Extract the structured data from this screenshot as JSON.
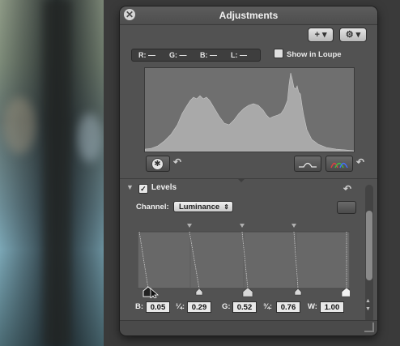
{
  "window": {
    "title": "Adjustments"
  },
  "toolbar": {
    "add_label": "+ ▾",
    "gear_label": "⚙ ▾"
  },
  "readout": {
    "r": "R: —",
    "g": "G: —",
    "b": "B: —",
    "l": "L: —"
  },
  "loupe": {
    "label": "Show in Loupe"
  },
  "levels": {
    "title": "Levels",
    "channel_label": "Channel:",
    "channel_value": "Luminance",
    "fields": [
      {
        "label": "B:",
        "value": "0.05"
      },
      {
        "label": "¼:",
        "value": "0.29"
      },
      {
        "label": "G:",
        "value": "0.52"
      },
      {
        "label": "¾:",
        "value": "0.76"
      },
      {
        "label": "W:",
        "value": "1.00"
      }
    ]
  },
  "icons": {
    "close": "close-icon",
    "auto": "auto-enhance-icon",
    "undo": "undo-icon",
    "curve": "curve-icon",
    "rgb": "rgb-histogram-icon"
  },
  "colors": {
    "panel": "#525252",
    "histogram_fill": "#a8a8a8"
  }
}
